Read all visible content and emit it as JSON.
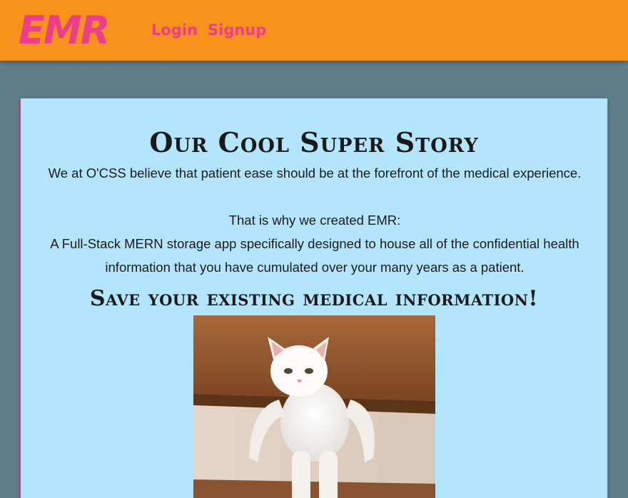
{
  "navbar": {
    "brand": "EMR",
    "links": [
      {
        "label": "Login"
      },
      {
        "label": "Signup"
      }
    ],
    "brand_color": "#ec3d8f",
    "background": "#f7931a"
  },
  "story": {
    "title": "Our Cool Super Story",
    "paragraph1": "We at O'CSS believe that patient ease should be at the forefront of the medical experience.",
    "paragraph2": "That is why we created EMR:",
    "paragraph3": "A Full-Stack MERN storage app specifically designed to house all of the confidential health information that you have cumulated over your many years as a patient.",
    "subtitle": "Save your existing medical information!",
    "image": "white-cat-standing-photo"
  },
  "colors": {
    "page_background": "#607d8b",
    "card_background": "#b3e5fc",
    "card_border": "#d2449a"
  }
}
